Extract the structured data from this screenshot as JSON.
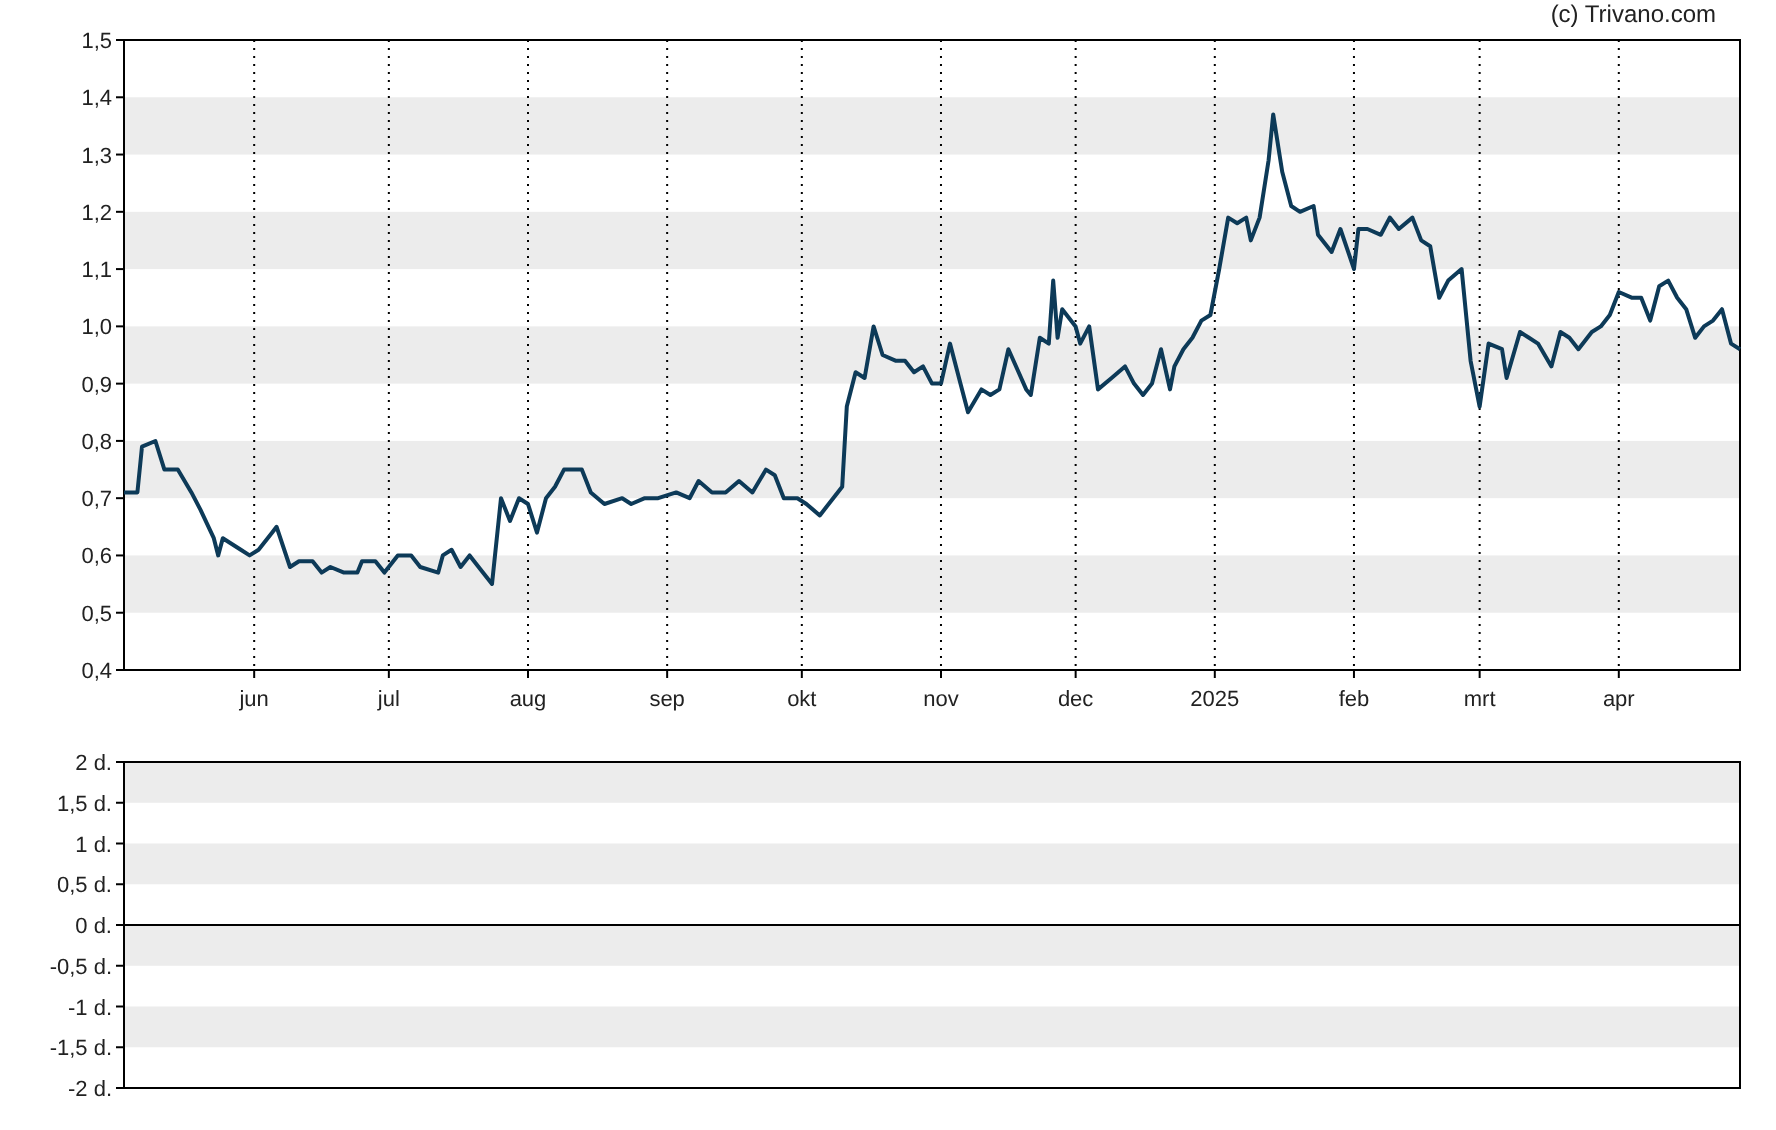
{
  "copyright": "(c) Trivano.com",
  "price_chart": {
    "chart_data": {
      "type": "line",
      "grid": true,
      "xlim": [
        "2024-05-03",
        "2025-04-28"
      ],
      "ylim": [
        0.4,
        1.5
      ],
      "xticks": [
        {
          "value": "2024-06-01",
          "label": "jun"
        },
        {
          "value": "2024-07-01",
          "label": "jul"
        },
        {
          "value": "2024-08-01",
          "label": "aug"
        },
        {
          "value": "2024-09-01",
          "label": "sep"
        },
        {
          "value": "2024-10-01",
          "label": "okt"
        },
        {
          "value": "2024-11-01",
          "label": "nov"
        },
        {
          "value": "2024-12-01",
          "label": "dec"
        },
        {
          "value": "2025-01-01",
          "label": "2025"
        },
        {
          "value": "2025-02-01",
          "label": "feb"
        },
        {
          "value": "2025-03-01",
          "label": "mrt"
        },
        {
          "value": "2025-04-01",
          "label": "apr"
        }
      ],
      "yticks": [
        {
          "value": 0.4,
          "label": "0,4"
        },
        {
          "value": 0.5,
          "label": "0,5"
        },
        {
          "value": 0.6,
          "label": "0,6"
        },
        {
          "value": 0.7,
          "label": "0,7"
        },
        {
          "value": 0.8,
          "label": "0,8"
        },
        {
          "value": 0.9,
          "label": "0,9"
        },
        {
          "value": 1.0,
          "label": "1,0"
        },
        {
          "value": 1.1,
          "label": "1,1"
        },
        {
          "value": 1.2,
          "label": "1,2"
        },
        {
          "value": 1.3,
          "label": "1,3"
        },
        {
          "value": 1.4,
          "label": "1,4"
        },
        {
          "value": 1.5,
          "label": "1,5"
        }
      ],
      "x": [
        "2024-05-03",
        "2024-05-06",
        "2024-05-07",
        "2024-05-10",
        "2024-05-12",
        "2024-05-15",
        "2024-05-18",
        "2024-05-20",
        "2024-05-23",
        "2024-05-24",
        "2024-05-25",
        "2024-05-29",
        "2024-05-31",
        "2024-06-02",
        "2024-06-05",
        "2024-06-06",
        "2024-06-09",
        "2024-06-11",
        "2024-06-14",
        "2024-06-16",
        "2024-06-18",
        "2024-06-21",
        "2024-06-24",
        "2024-06-25",
        "2024-06-28",
        "2024-06-30",
        "2024-07-03",
        "2024-07-06",
        "2024-07-08",
        "2024-07-12",
        "2024-07-13",
        "2024-07-15",
        "2024-07-17",
        "2024-07-19",
        "2024-07-21",
        "2024-07-24",
        "2024-07-26",
        "2024-07-28",
        "2024-07-30",
        "2024-08-01",
        "2024-08-03",
        "2024-08-05",
        "2024-08-07",
        "2024-08-09",
        "2024-08-13",
        "2024-08-15",
        "2024-08-18",
        "2024-08-22",
        "2024-08-24",
        "2024-08-27",
        "2024-08-30",
        "2024-09-03",
        "2024-09-06",
        "2024-09-08",
        "2024-09-11",
        "2024-09-14",
        "2024-09-17",
        "2024-09-20",
        "2024-09-23",
        "2024-09-25",
        "2024-09-27",
        "2024-09-30",
        "2024-10-02",
        "2024-10-05",
        "2024-10-08",
        "2024-10-10",
        "2024-10-11",
        "2024-10-13",
        "2024-10-15",
        "2024-10-17",
        "2024-10-19",
        "2024-10-22",
        "2024-10-24",
        "2024-10-26",
        "2024-10-28",
        "2024-10-30",
        "2024-11-01",
        "2024-11-03",
        "2024-11-05",
        "2024-11-07",
        "2024-11-10",
        "2024-11-12",
        "2024-11-14",
        "2024-11-16",
        "2024-11-20",
        "2024-11-21",
        "2024-11-23",
        "2024-11-25",
        "2024-11-26",
        "2024-11-27",
        "2024-11-28",
        "2024-12-01",
        "2024-12-02",
        "2024-12-04",
        "2024-12-06",
        "2024-12-09",
        "2024-12-12",
        "2024-12-14",
        "2024-12-16",
        "2024-12-18",
        "2024-12-20",
        "2024-12-22",
        "2024-12-23",
        "2024-12-25",
        "2024-12-27",
        "2024-12-29",
        "2024-12-31",
        "2025-01-02",
        "2025-01-04",
        "2025-01-06",
        "2025-01-08",
        "2025-01-09",
        "2025-01-11",
        "2025-01-13",
        "2025-01-14",
        "2025-01-16",
        "2025-01-18",
        "2025-01-20",
        "2025-01-23",
        "2025-01-24",
        "2025-01-27",
        "2025-01-29",
        "2025-02-01",
        "2025-02-02",
        "2025-02-04",
        "2025-02-07",
        "2025-02-09",
        "2025-02-11",
        "2025-02-14",
        "2025-02-16",
        "2025-02-18",
        "2025-02-20",
        "2025-02-22",
        "2025-02-25",
        "2025-02-27",
        "2025-03-01",
        "2025-03-03",
        "2025-03-06",
        "2025-03-07",
        "2025-03-10",
        "2025-03-12",
        "2025-03-14",
        "2025-03-17",
        "2025-03-19",
        "2025-03-21",
        "2025-03-23",
        "2025-03-26",
        "2025-03-28",
        "2025-03-30",
        "2025-04-01",
        "2025-04-04",
        "2025-04-06",
        "2025-04-08",
        "2025-04-10",
        "2025-04-12",
        "2025-04-14",
        "2025-04-16",
        "2025-04-18",
        "2025-04-20",
        "2025-04-22",
        "2025-04-24",
        "2025-04-26",
        "2025-04-28"
      ],
      "series": [
        {
          "color": "#0d3a58",
          "values": [
            0.71,
            0.71,
            0.79,
            0.8,
            0.75,
            0.75,
            0.71,
            0.68,
            0.63,
            0.6,
            0.63,
            0.61,
            0.6,
            0.61,
            0.64,
            0.65,
            0.58,
            0.59,
            0.59,
            0.57,
            0.58,
            0.57,
            0.57,
            0.59,
            0.59,
            0.57,
            0.6,
            0.6,
            0.58,
            0.57,
            0.6,
            0.61,
            0.58,
            0.6,
            0.58,
            0.55,
            0.7,
            0.66,
            0.7,
            0.69,
            0.64,
            0.7,
            0.72,
            0.75,
            0.75,
            0.71,
            0.69,
            0.7,
            0.69,
            0.7,
            0.7,
            0.71,
            0.7,
            0.73,
            0.71,
            0.71,
            0.73,
            0.71,
            0.75,
            0.74,
            0.7,
            0.7,
            0.69,
            0.67,
            0.7,
            0.72,
            0.86,
            0.92,
            0.91,
            1.0,
            0.95,
            0.94,
            0.94,
            0.92,
            0.93,
            0.9,
            0.9,
            0.97,
            0.91,
            0.85,
            0.89,
            0.88,
            0.89,
            0.96,
            0.89,
            0.88,
            0.98,
            0.97,
            1.08,
            0.98,
            1.03,
            1.0,
            0.97,
            1.0,
            0.89,
            0.91,
            0.93,
            0.9,
            0.88,
            0.9,
            0.96,
            0.89,
            0.93,
            0.96,
            0.98,
            1.01,
            1.02,
            1.1,
            1.19,
            1.18,
            1.19,
            1.15,
            1.19,
            1.29,
            1.37,
            1.27,
            1.21,
            1.2,
            1.21,
            1.16,
            1.13,
            1.17,
            1.1,
            1.17,
            1.17,
            1.16,
            1.19,
            1.17,
            1.19,
            1.15,
            1.14,
            1.05,
            1.08,
            1.1,
            0.94,
            0.86,
            0.97,
            0.96,
            0.91,
            0.99,
            0.98,
            0.97,
            0.93,
            0.99,
            0.98,
            0.96,
            0.99,
            1.0,
            1.02,
            1.06,
            1.05,
            1.05,
            1.01,
            1.07,
            1.08,
            1.05,
            1.03,
            0.98,
            1.0,
            1.01,
            1.03,
            0.97,
            0.96
          ]
        }
      ]
    }
  },
  "lower_panel": {
    "axis_labels": [
      "2 d.",
      "1,5 d.",
      "1 d.",
      "0,5 d.",
      "0 d.",
      "-0,5 d.",
      "-1 d.",
      "-1,5 d.",
      "-2 d."
    ]
  }
}
